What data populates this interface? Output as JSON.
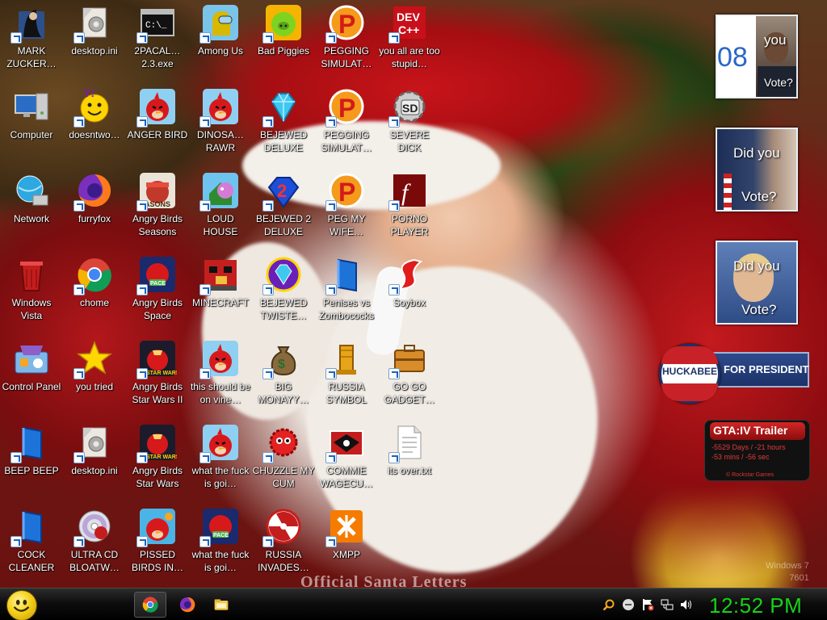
{
  "desktop": {
    "watermark": "Official Santa Letters",
    "os_version_lines": [
      "Windows 7",
      "7601"
    ]
  },
  "icons": [
    {
      "label": "MARK ZUCKER…",
      "icon": "person-folder-icon"
    },
    {
      "label": "desktop.ini",
      "icon": "settings-file-icon"
    },
    {
      "label": "2PACAL… 2.3.exe",
      "icon": "console-app-icon"
    },
    {
      "label": "Among Us",
      "icon": "among-us-icon"
    },
    {
      "label": "Bad Piggies",
      "icon": "bad-piggies-icon"
    },
    {
      "label": "PEGGING SIMULAT…",
      "icon": "p-logo-icon"
    },
    {
      "label": "you all are too stupid…",
      "icon": "dev-cpp-icon"
    },
    {
      "label": "Computer",
      "icon": "computer-icon"
    },
    {
      "label": "doesntwo…",
      "icon": "yahoo-messenger-icon"
    },
    {
      "label": "ANGER BIRD",
      "icon": "angry-bird-icon"
    },
    {
      "label": "DINOSA… RAWR",
      "icon": "angry-bird-icon"
    },
    {
      "label": "BEJEWED DELUXE",
      "icon": "gem-icon"
    },
    {
      "label": "PEGGING SIMULAT…",
      "icon": "p-logo-icon"
    },
    {
      "label": "SEVERE DICK",
      "icon": "sd-gear-icon"
    },
    {
      "label": "Network",
      "icon": "network-globe-icon"
    },
    {
      "label": "furryfox",
      "icon": "firefox-icon"
    },
    {
      "label": "Angry Birds Seasons",
      "icon": "angry-birds-seasons-icon"
    },
    {
      "label": "LOUD HOUSE",
      "icon": "loud-house-icon"
    },
    {
      "label": "BEJEWED 2 DELUXE",
      "icon": "bejeweled-2-icon"
    },
    {
      "label": "PEG MY WIFE…",
      "icon": "p-logo-icon"
    },
    {
      "label": "PORNO PLAYER",
      "icon": "flash-player-icon"
    },
    {
      "label": "Windows Vista",
      "icon": "recycle-bin-icon"
    },
    {
      "label": "chome",
      "icon": "chrome-icon"
    },
    {
      "label": "Angry Birds Space",
      "icon": "angry-birds-space-icon"
    },
    {
      "label": "MINECRAFT",
      "icon": "minecraft-bird-icon"
    },
    {
      "label": "BEJEWED TWISTE…",
      "icon": "bejeweled-twist-icon"
    },
    {
      "label": "Penises vs Zombococks",
      "icon": "blue-book-icon"
    },
    {
      "label": "Soybox",
      "icon": "soybox-icon"
    },
    {
      "label": "Control Panel",
      "icon": "control-panel-icon"
    },
    {
      "label": "you tried",
      "icon": "star-icon"
    },
    {
      "label": "Angry Birds Star Wars II",
      "icon": "angry-birds-star-wars-icon"
    },
    {
      "label": "this should be on vine…",
      "icon": "angry-bird-icon"
    },
    {
      "label": "BIG MONAYY…",
      "icon": "money-bag-icon"
    },
    {
      "label": "RUSSIA SYMBOL",
      "icon": "gold-statue-icon"
    },
    {
      "label": "GO GO GADGET…",
      "icon": "briefcase-icon"
    },
    {
      "label": "BEEP BEEP",
      "icon": "blue-book-icon"
    },
    {
      "label": "desktop.ini",
      "icon": "settings-file-icon"
    },
    {
      "label": "Angry Birds Star Wars",
      "icon": "angry-birds-star-wars-icon"
    },
    {
      "label": "what the fuck is goi…",
      "icon": "angry-bird-icon"
    },
    {
      "label": "CHUZZLE MY CUM",
      "icon": "chuzzle-icon"
    },
    {
      "label": "COMMIE WAGECU…",
      "icon": "eagle-flag-icon"
    },
    {
      "label": "its over.txt",
      "icon": "text-file-icon"
    },
    {
      "label": "COCK CLEANER",
      "icon": "blue-book-icon"
    },
    {
      "label": "ULTRA CD BLOATW…",
      "icon": "cd-icon"
    },
    {
      "label": "PISSED BIRDS IN…",
      "icon": "angry-bird-rio-icon"
    },
    {
      "label": "what the fuck is goi…",
      "icon": "angry-birds-space-icon"
    },
    {
      "label": "RUSSIA INVADES…",
      "icon": "radiation-icon"
    },
    {
      "label": "XMPP",
      "icon": "xampp-icon"
    }
  ],
  "gadgets": {
    "vote1": {
      "text_a": "you",
      "text_b": "Vote?",
      "year": "08"
    },
    "vote2": {
      "text_a": "Did you",
      "text_b": "Vote?"
    },
    "vote3": {
      "text_a": "Did you",
      "text_b": "Vote?"
    },
    "huckabee": {
      "name": "HUCKABEE",
      "slogan": "FOR PRESIDENT"
    },
    "gta": {
      "title": "GTA:IV Trailer",
      "line1": "-5529 Days / -21 hours",
      "line2": "-53 mins / -56 sec",
      "footer": "© Rockstar Games"
    }
  },
  "taskbar": {
    "pinned": [
      "chrome-icon",
      "firefox-icon",
      "explorer-folder-icon"
    ],
    "tray": [
      "search-icon",
      "messenger-icon",
      "action-center-flag-icon",
      "network-icon",
      "volume-icon"
    ],
    "clock": "12:52 PM"
  },
  "colors": {
    "clock": "#17d317",
    "taskbar": "#0e0e0e",
    "label": "#ffffff"
  }
}
